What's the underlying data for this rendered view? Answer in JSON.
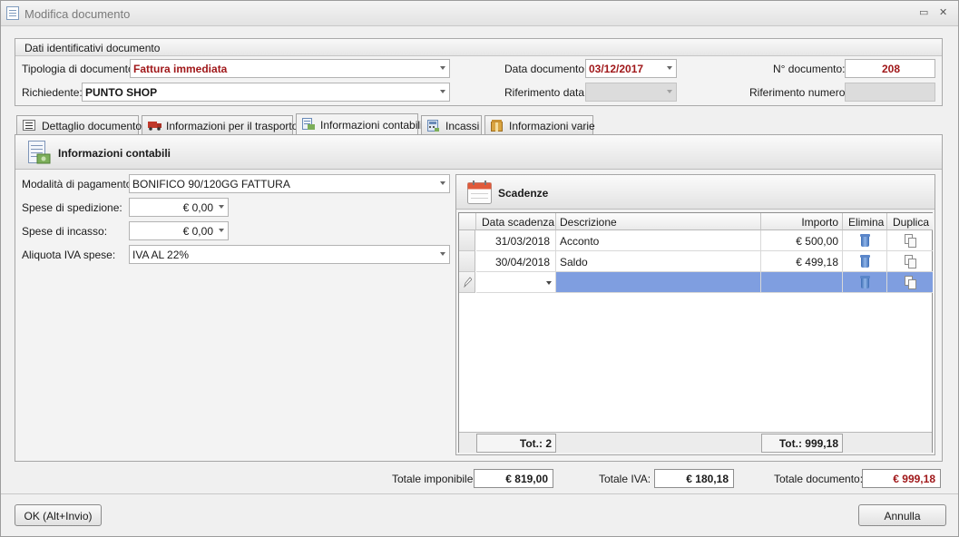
{
  "window": {
    "title": "Modifica documento"
  },
  "ident_group": {
    "title": "Dati identificativi documento",
    "tipologia_label": "Tipologia di documento:",
    "tipologia_value": "Fattura immediata",
    "richiedente_label": "Richiedente:",
    "richiedente_value": "PUNTO SHOP",
    "data_documento_label": "Data documento:",
    "data_documento_value": "03/12/2017",
    "riferimento_data_label": "Riferimento data:",
    "riferimento_data_value": "",
    "numero_documento_label": "N° documento:",
    "numero_documento_value": "208",
    "riferimento_numero_label": "Riferimento numero:",
    "riferimento_numero_value": ""
  },
  "tabs": [
    {
      "label": "Dettaglio documento",
      "icon": "document-list-icon",
      "active": false
    },
    {
      "label": "Informazioni per il trasporto",
      "icon": "truck-icon",
      "active": false
    },
    {
      "label": "Informazioni contabili",
      "icon": "accounting-icon",
      "active": true
    },
    {
      "label": "Incassi",
      "icon": "calculator-icon",
      "active": false
    },
    {
      "label": "Informazioni varie",
      "icon": "package-icon",
      "active": false
    }
  ],
  "accounting": {
    "section_title": "Informazioni contabili",
    "modalita_label": "Modalità di pagamento:",
    "modalita_value": "BONIFICO 90/120GG FATTURA",
    "spese_spedizione_label": "Spese di spedizione:",
    "spese_spedizione_value": "€ 0,00",
    "spese_incasso_label": "Spese di incasso:",
    "spese_incasso_value": "€ 0,00",
    "aliquota_label": "Aliquota IVA spese:",
    "aliquota_value": "IVA AL 22%"
  },
  "scadenze": {
    "title": "Scadenze",
    "columns": [
      "Data scadenza",
      "Descrizione",
      "Importo",
      "Elimina",
      "Duplica"
    ],
    "rows": [
      {
        "data": "31/03/2018",
        "descrizione": "Acconto",
        "importo": "€ 500,00"
      },
      {
        "data": "30/04/2018",
        "descrizione": "Saldo",
        "importo": "€ 499,18"
      }
    ],
    "footer_count": "Tot.: 2",
    "footer_total": "Tot.: 999,18"
  },
  "totals": {
    "imponibile_label": "Totale imponibile:",
    "imponibile_value": "€ 819,00",
    "iva_label": "Totale IVA:",
    "iva_value": "€ 180,18",
    "documento_label": "Totale documento:",
    "documento_value": "€ 999,18"
  },
  "buttons": {
    "ok_label": "OK (Alt+Invio)",
    "annulla_label": "Annulla"
  },
  "colors": {
    "accent_red": "#a0181a",
    "selection_blue": "#7f9ee0"
  }
}
